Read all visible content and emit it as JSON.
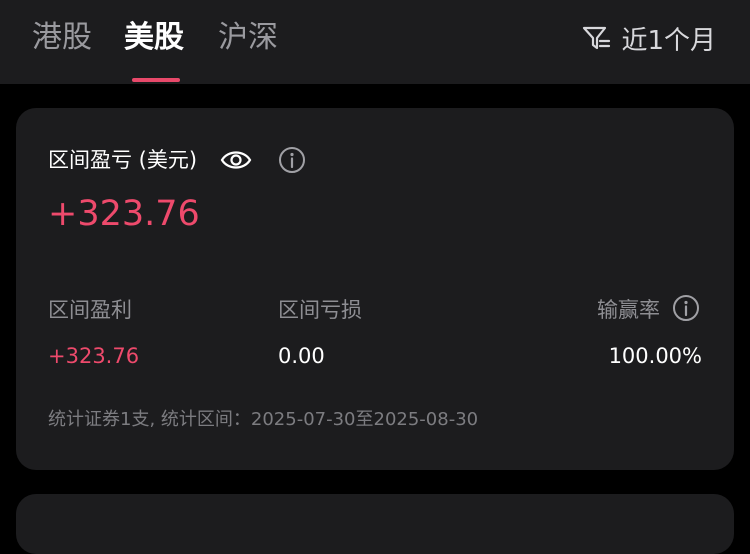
{
  "tabs": {
    "hk": "港股",
    "us": "美股",
    "sh": "沪深",
    "active": "美股"
  },
  "filter": {
    "icon": "filter-icon",
    "label": "近1个月"
  },
  "card": {
    "title": "区间盈亏 (美元)",
    "total_value": "+323.76",
    "profit_label": "区间盈利",
    "profit_value": "+323.76",
    "loss_label": "区间亏损",
    "loss_value": "0.00",
    "winrate_label": "输赢率",
    "winrate_value": "100.00%",
    "footnote": "统计证券1支, 统计区间：2025-07-30至2025-08-30"
  },
  "colors": {
    "accent": "#e8496a",
    "positive": "#ee4a6c",
    "card_bg": "#1c1c1e",
    "page_bg": "#000000"
  }
}
